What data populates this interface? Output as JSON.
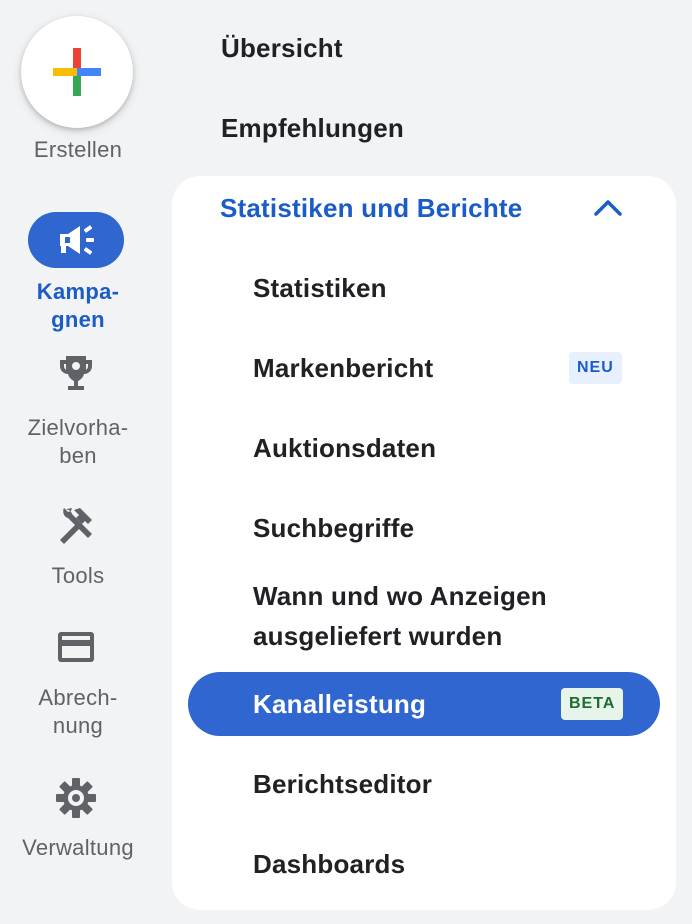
{
  "rail": {
    "create_label": "Erstellen",
    "campaigns_label_1": "Kampa-",
    "campaigns_label_2": "gnen",
    "goals_label_1": "Zielvorha-",
    "goals_label_2": "ben",
    "tools_label": "Tools",
    "billing_label_1": "Abrech-",
    "billing_label_2": "nung",
    "admin_label": "Verwaltung"
  },
  "menu": {
    "overview": "Übersicht",
    "recommendations": "Empfehlungen",
    "section_title": "Statistiken und Berichte",
    "items": [
      {
        "label": "Statistiken"
      },
      {
        "label": "Markenbericht",
        "badge": "NEU"
      },
      {
        "label": "Auktionsdaten"
      },
      {
        "label": "Suchbegriffe"
      },
      {
        "label": "Wann und wo Anzeigen",
        "label2": "ausgeliefert wurden"
      },
      {
        "label": "Kanalleistung",
        "badge": "BETA"
      },
      {
        "label": "Berichtseditor"
      },
      {
        "label": "Dashboards"
      }
    ]
  },
  "colors": {
    "accent": "#1a5cc8",
    "active_fill": "#2f66d0",
    "background": "#f1f3f4",
    "neu_badge_bg": "#e8f0fe",
    "beta_badge_bg": "#e6f4ea"
  }
}
